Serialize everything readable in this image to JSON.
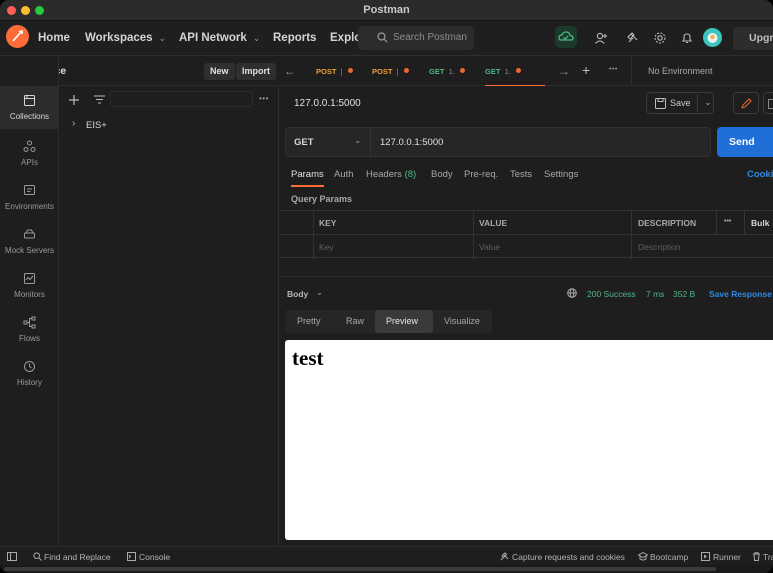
{
  "window": {
    "title": "Postman"
  },
  "topnav": {
    "home": "Home",
    "workspaces": "Workspaces",
    "api_network": "API Network",
    "reports": "Reports",
    "explore": "Explo",
    "search_placeholder": "Search Postman",
    "upgrade": "Upgr"
  },
  "workspace": {
    "name": "practice",
    "new_label": "New",
    "import_label": "Import"
  },
  "rail": [
    {
      "label": "Collections",
      "icon": "collections-icon"
    },
    {
      "label": "APIs",
      "icon": "apis-icon"
    },
    {
      "label": "Environments",
      "icon": "environments-icon"
    },
    {
      "label": "Mock Servers",
      "icon": "mock-servers-icon"
    },
    {
      "label": "Monitors",
      "icon": "monitors-icon"
    },
    {
      "label": "Flows",
      "icon": "flows-icon"
    },
    {
      "label": "History",
      "icon": "history-icon"
    }
  ],
  "collections": [
    {
      "name": "EIS+"
    }
  ],
  "tabs": [
    {
      "method": "POST",
      "name": "|"
    },
    {
      "method": "POST",
      "name": "|"
    },
    {
      "method": "GET",
      "name": "1."
    },
    {
      "method": "GET",
      "name": "1."
    }
  ],
  "environment": "No Environment",
  "request": {
    "title": "127.0.0.1:5000",
    "save": "Save",
    "method": "GET",
    "url": "127.0.0.1:5000",
    "send": "Send"
  },
  "req_tabs": {
    "params": "Params",
    "auth": "Auth",
    "headers": "Headers",
    "headers_count": "(8)",
    "body": "Body",
    "prereq": "Pre-req.",
    "tests": "Tests",
    "settings": "Settings",
    "cookies": "Cooki"
  },
  "params": {
    "section_title": "Query Params",
    "columns": {
      "key": "KEY",
      "value": "VALUE",
      "description": "DESCRIPTION",
      "more": "•••",
      "bulk": "Bulk"
    },
    "placeholders": {
      "key": "Key",
      "value": "Value",
      "description": "Description"
    }
  },
  "response": {
    "body_label": "Body",
    "status": "200 Success",
    "time": "7 ms",
    "size": "352 B",
    "save_response": "Save Response",
    "view_tabs": [
      "Pretty",
      "Raw",
      "Preview",
      "Visualize"
    ],
    "active_view": "Preview",
    "preview_text": "test"
  },
  "statusbar": {
    "find_replace": "Find and Replace",
    "console": "Console",
    "capture": "Capture requests and cookies",
    "bootcamp": "Bootcamp",
    "runner": "Runner",
    "trash": "Tra"
  },
  "colors": {
    "accent_orange": "#ff6c37",
    "send_blue": "#1f6fd6",
    "link_blue": "#2e8ae6",
    "success_green": "#4fb886",
    "post_orange": "#ef9f3b",
    "get_green": "#4fb886"
  }
}
